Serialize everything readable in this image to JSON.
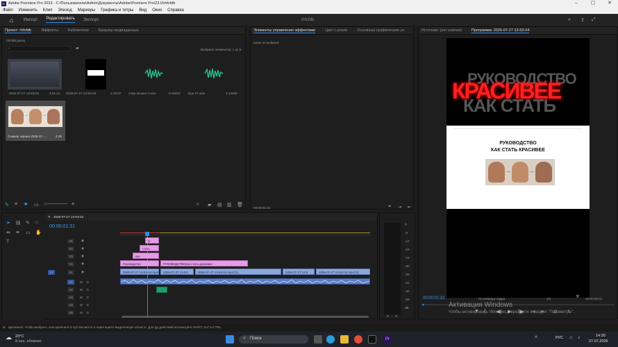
{
  "titlebar": {
    "title": "Adobe Premiere Pro 2023 - C:\\Пользователи\\Admin\\Документы\\Adobe\\Premiere Pro\\23.0\\rhfcfdb",
    "app_icon_text": "Pr"
  },
  "menu": [
    "Файл",
    "Изменить",
    "Клип",
    "Эпизод",
    "Маркеры",
    "Графика и титры",
    "Вид",
    "Окно",
    "Справка"
  ],
  "workspace": {
    "tabs": [
      "Импорт",
      "Редактировать",
      "Экспорт"
    ],
    "active": "Редактировать",
    "project_title": "rhfcfdb"
  },
  "project_panel": {
    "tabs": [
      "Проект: rhfcfdb",
      "Эффекты",
      "Библиотеки",
      "Браузер медиаданных"
    ],
    "file": "rhfcfdb.prproj",
    "selection": "Выбрано элементов: 1 из 5",
    "items": [
      {
        "name": "2026-07-27 13-53-04",
        "duration": "2:51:41"
      },
      {
        "name": "2026-07-27 13-53-04",
        "duration": "2:19:37"
      },
      {
        "name": "хлюк вышел 2.wav",
        "duration": "0:15613"
      },
      {
        "name": "вуш 37.wav",
        "duration": "1:14268"
      },
      {
        "name": "Снимок экрана 2026-07-...",
        "duration": "4;29"
      }
    ]
  },
  "effects_panel": {
    "tabs": [
      "Элементы управления эффектами",
      "Цвет Lumetri",
      "Основные графические эл"
    ],
    "no_clip": "(клип не выбран)",
    "time": "00:00:01:31"
  },
  "source_monitor": {
    "label": "Источник: (нет клипов)"
  },
  "program_monitor": {
    "label": "Программа: 2026-07-27 13-53-04",
    "big_text_line1": "РУКОВОДСТВО",
    "big_text_line2": "КРАСИВЕЕ",
    "big_text_line3": "КАК СТАТЬ",
    "page_title_line1": "РУКОВОДСТВО",
    "page_title_line2": "КАК СТАТЬ КРАСИВЕЕ",
    "timecode": "00:00:01:31",
    "fit": "По размеру кадра",
    "ratio": "1/2",
    "end_timecode": "00:00:00:01"
  },
  "timeline": {
    "sequence": "2026-07-27 13-53-04",
    "timecode": "00:00:01:31",
    "tracks_video": [
      "V5",
      "V4",
      "V3",
      "V2",
      "V1"
    ],
    "tracks_audio": [
      "A1",
      "A2",
      "A3",
      "A4",
      "A5"
    ],
    "clips": {
      "v5": "fx",
      "v4": "стать",
      "v3": "как",
      "v2a": "Руководство",
      "v2b": "РУКОВОДСТВОкак стать красивее",
      "v1a": "2026-07-27 13-53-04.mp4",
      "v1b": "2026-07-27 13-53-",
      "v1c": "2026-07-27 13-53-04.mp4 [V]",
      "v1d": "2026-07-27 13:5",
      "v1e": "2026-07-27 13-53-04.mp4 [V]"
    },
    "meter_labels": [
      "0",
      "-6",
      "-12",
      "-18",
      "-24",
      "-30",
      "-36",
      "-42",
      "-48",
      "-54",
      "dB"
    ],
    "meter_bottom": [
      "S",
      "S"
    ]
  },
  "statusbar": {
    "text": "Щелкните, чтобы выбрать, или щелкните в пустом месте и перетащите выделенную область. Для др.действий используйте SHIFT, ALT и CTRL."
  },
  "activation": {
    "title": "Активация Windows",
    "sub": "Чтобы активировать Windows, перейдите в раздел \"Параметры\"."
  },
  "taskbar": {
    "weather_temp": "23°C",
    "weather_desc": "8 осн. облачно",
    "search": "Поиск",
    "lang": "РУС",
    "time": "14:30",
    "date": "27.07.2026"
  },
  "colors": {
    "accent": "#2d8ceb",
    "clip_pink": "#e59be6",
    "clip_blue": "#8aa8dc",
    "taskbar": "#20222a"
  }
}
